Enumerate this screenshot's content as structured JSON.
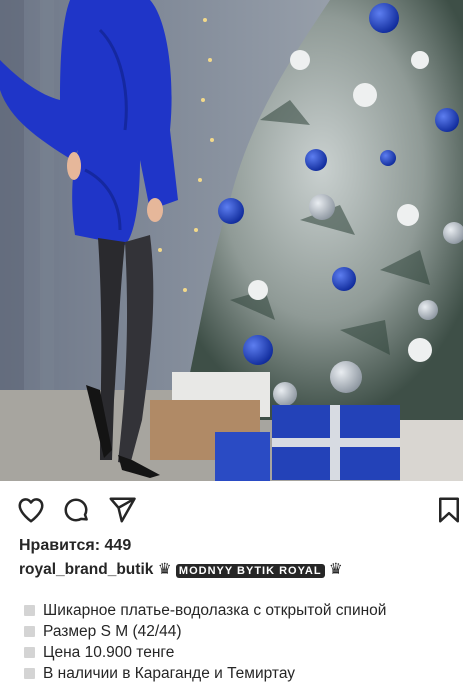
{
  "post": {
    "likes_label": "Нравится: 449",
    "username": "royal_brand_butik",
    "caption_crown": "♛",
    "caption_brand": "MODNYY BYTIK ROYAL",
    "caption_crown_end": "♛",
    "bullets": [
      "Шикарное платье-водолазка с открытой спиной",
      "Размер  S M (42/44)",
      "Цена 10.900 тенге",
      "В наличии в Караганде и Темиртау"
    ]
  },
  "icons": {
    "like": "heart-icon",
    "comment": "comment-icon",
    "share": "send-icon",
    "save": "bookmark-icon"
  },
  "colors": {
    "dress": "#1f35c8",
    "tree": "#2d4a3a",
    "ornament": "#1b3fb5",
    "text": "#262626"
  }
}
